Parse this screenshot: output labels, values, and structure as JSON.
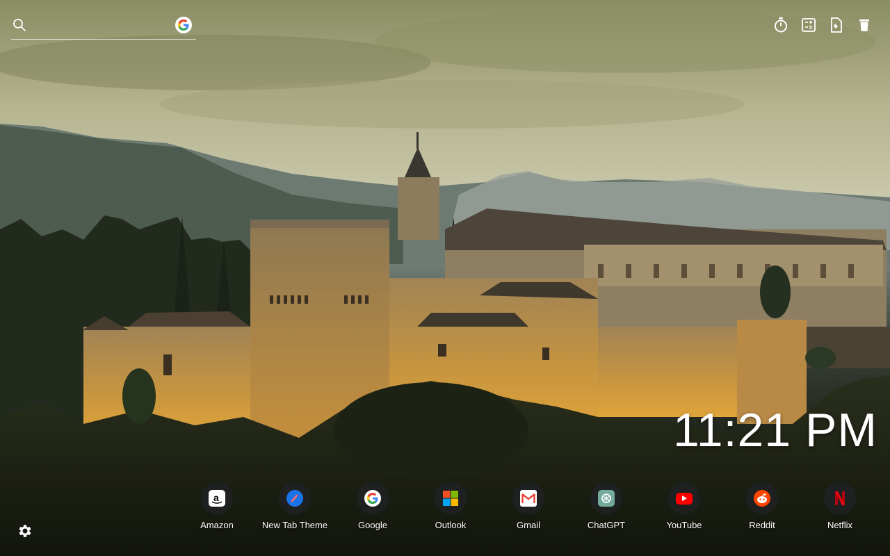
{
  "search": {
    "placeholder": "",
    "icon": "search-icon",
    "engine_icon": "google-icon"
  },
  "tools": [
    {
      "name": "timer-icon"
    },
    {
      "name": "calculator-icon"
    },
    {
      "name": "notes-icon"
    },
    {
      "name": "trash-icon"
    }
  ],
  "clock": {
    "time": "11:21 PM"
  },
  "shortcuts": [
    {
      "label": "Amazon",
      "icon": "amazon-icon",
      "color": "#ffffff"
    },
    {
      "label": "New Tab Theme",
      "icon": "new-tab-theme-icon",
      "color": "#1a73e8"
    },
    {
      "label": "Google",
      "icon": "google-icon",
      "color": "#ffffff"
    },
    {
      "label": "Outlook",
      "icon": "outlook-icon",
      "color": "#f25022"
    },
    {
      "label": "Gmail",
      "icon": "gmail-icon",
      "color": "#ea4335"
    },
    {
      "label": "ChatGPT",
      "icon": "chatgpt-icon",
      "color": "#74aa9c"
    },
    {
      "label": "YouTube",
      "icon": "youtube-icon",
      "color": "#ff0000"
    },
    {
      "label": "Reddit",
      "icon": "reddit-icon",
      "color": "#ff4500"
    },
    {
      "label": "Netflix",
      "icon": "netflix-icon",
      "color": "#e50914"
    }
  ],
  "settings": {
    "icon": "gear-icon"
  }
}
